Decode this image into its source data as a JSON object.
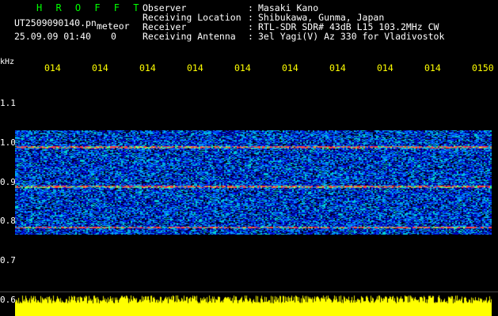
{
  "header": {
    "brand": "H R O F F T",
    "filename": "UT2509090140.pn",
    "meteor_label": "meteor",
    "datetime": "25.09.09 01:40",
    "count": "0",
    "observer_label": "Observer",
    "location_label": "Receiving Location",
    "receiver_label": "Receiver",
    "antenna_label": "Receiving Antenna",
    "separator": ":",
    "observer": "Masaki Kano",
    "location": "Shibukawa, Gunma, Japan",
    "receiver": "RTL-SDR SDR# 43dB L15 103.2MHz CW",
    "antenna": "3el Yagi(V) Az 330 for Vladivostok"
  },
  "time_ticks": [
    "014",
    "014",
    "014",
    "014",
    "014",
    "014",
    "014",
    "014",
    "014",
    "0150"
  ],
  "yaxis": {
    "unit": "kHz",
    "labels": [
      "1.1",
      "1.0",
      "0.9",
      "0.8",
      "0.7",
      "0.6"
    ]
  },
  "colors": {
    "background": "#000000",
    "brand": "#00ff00",
    "ticks": "#ffff00",
    "text": "#ffffff",
    "histogram": "#ffff00"
  }
}
